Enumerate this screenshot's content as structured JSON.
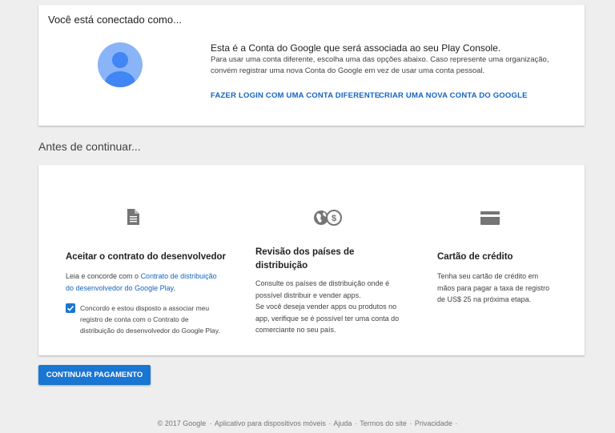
{
  "account": {
    "heading": "Você está conectado como...",
    "title": "Esta é a Conta do Google que será associada ao seu Play Console.",
    "description": "Para usar uma conta diferente, escolha uma das opções abaixo. Caso represente uma organização, convém registrar uma nova Conta do Google em vez de usar uma conta pessoal.",
    "login_link": "FAZER LOGIN COM UMA CONTA DIFERENTE",
    "create_link": "CRIAR UMA NOVA CONTA DO GOOGLE"
  },
  "section_title": "Antes de continuar...",
  "contract": {
    "title": "Aceitar o contrato do desenvolvedor",
    "text_prefix": "Leia e concorde com o ",
    "link": "Contrato de distribuição do desenvolvedor do Google Play",
    "text_suffix": ".",
    "agree_text": "Concordo e estou disposto a associar meu registro de conta com o Contrato de distribuição do desenvolvedor do Google Play.",
    "checked": true
  },
  "countries": {
    "title": "Revisão dos países de distribuição",
    "text1": "Consulte os países de distribuição onde é possível distribuir e vender apps.",
    "text2": "Se você deseja vender apps ou produtos no app, verifique se é possível ter uma conta do comerciante no seu país."
  },
  "credit": {
    "title": "Cartão de crédito",
    "text": "Tenha seu cartão de crédito em mãos para pagar a taxa de registro de US$ 25 na próxima etapa."
  },
  "continue_button": "CONTINUAR PAGAMENTO",
  "footer": {
    "copyright": "© 2017 Google",
    "links": [
      "Aplicativo para dispositivos móveis",
      "Ajuda",
      "Termos do site",
      "Privacidade"
    ],
    "separator": "·"
  },
  "colors": {
    "accent": "#1976d2",
    "link": "#1565c0",
    "background": "#eeeeee",
    "avatar": "#8ab4f8"
  },
  "icons": [
    "avatar-icon",
    "document-icon",
    "globe-dollar-icon",
    "credit-card-icon",
    "checkmark-icon"
  ]
}
